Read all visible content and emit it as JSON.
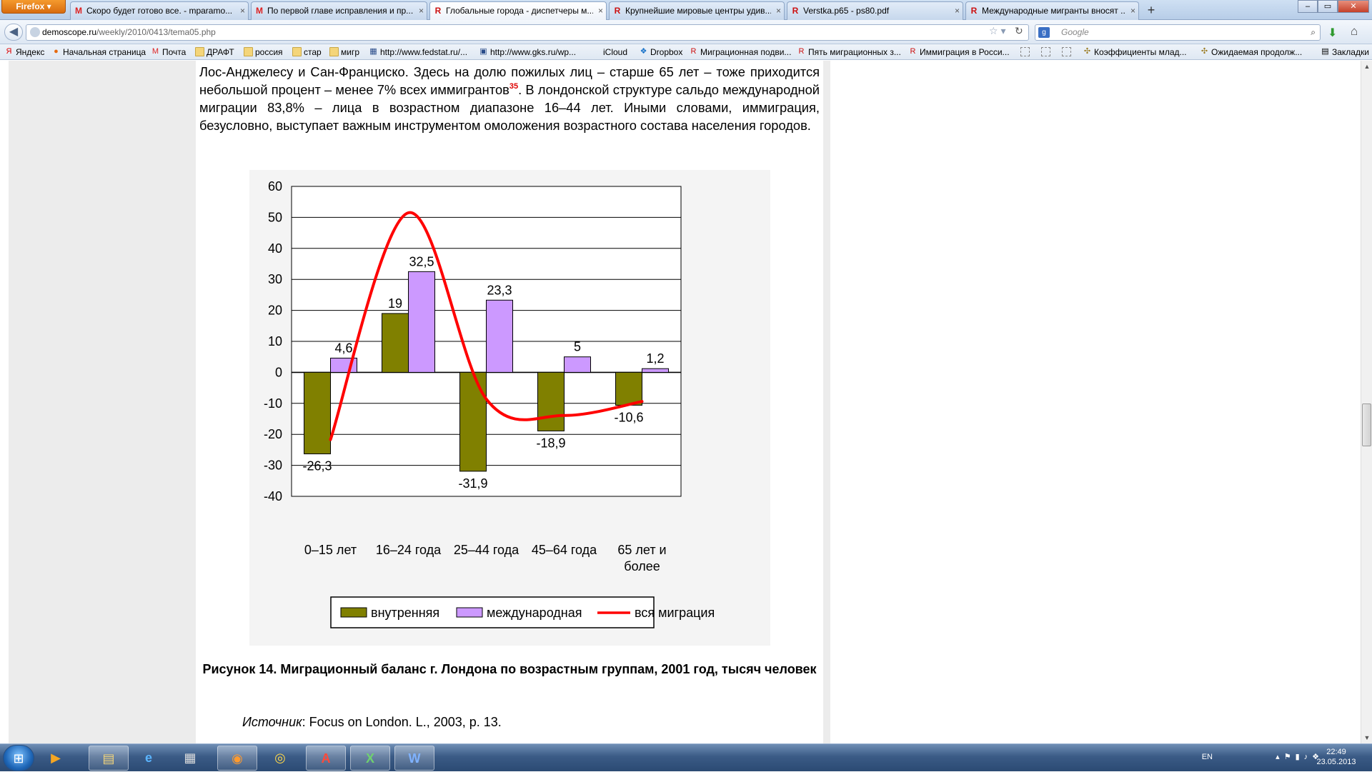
{
  "browser": {
    "menu_button": "Firefox",
    "tabs": [
      {
        "icon": "gmail-icon",
        "label": "Скоро будет готово все. - mparamo...",
        "active": false
      },
      {
        "icon": "gmail-icon",
        "label": "По первой главе исправления и пр...",
        "active": false
      },
      {
        "icon": "demoscope-icon",
        "label": "Глобальные города - диспетчеры м...",
        "active": true
      },
      {
        "icon": "demoscope-icon",
        "label": "Крупнейшие мировые центры удив...",
        "active": false
      },
      {
        "icon": "demoscope-icon",
        "label": "Verstka.p65 - ps80.pdf",
        "active": false
      },
      {
        "icon": "demoscope-icon",
        "label": "Международные мигранты вносят ...",
        "active": false
      }
    ],
    "new_tab": "+",
    "url_domain": "demoscope.ru",
    "url_path": "/weekly/2010/0413/tema05.php",
    "search_placeholder": "Google",
    "bookmarks": [
      {
        "label": "Яндекс",
        "icon": "yandex-icon"
      },
      {
        "label": "Начальная страница",
        "icon": "firefox-icon"
      },
      {
        "label": "Почта",
        "icon": "gmail-icon"
      },
      {
        "label": "ДРАФТ",
        "icon": "folder-icon"
      },
      {
        "label": "россия",
        "icon": "folder-icon"
      },
      {
        "label": "стар",
        "icon": "folder-icon"
      },
      {
        "label": "мигр",
        "icon": "folder-icon"
      },
      {
        "label": "http://www.fedstat.ru/...",
        "icon": "fedstat-icon"
      },
      {
        "label": "http://www.gks.ru/wp...",
        "icon": "gks-icon"
      },
      {
        "label": "iCloud",
        "icon": "apple-icon"
      },
      {
        "label": "Dropbox",
        "icon": "dropbox-icon"
      },
      {
        "label": "Миграционная подви...",
        "icon": "demoscope-icon"
      },
      {
        "label": "Пять миграционных з...",
        "icon": "demoscope-icon"
      },
      {
        "label": "Иммиграция в Росси...",
        "icon": "demoscope-icon"
      },
      {
        "label": "",
        "icon": "blank-page-icon"
      },
      {
        "label": "",
        "icon": "blank-page-icon"
      },
      {
        "label": "",
        "icon": "blank-page-icon"
      },
      {
        "label": "Коэффициенты млад...",
        "icon": "emblem-icon"
      },
      {
        "label": "Ожидаемая продолж...",
        "icon": "emblem-icon"
      }
    ],
    "bookmarks_menu": "Закладки"
  },
  "article": {
    "paragraph_before_sup": "Лос-Анджелесу и Сан-Франциско. Здесь на долю пожилых лиц – старше 65 лет – тоже приходится небольшой процент – менее 7% всех иммигрантов",
    "footnote": "35",
    "paragraph_after_sup": ". В лондонской структуре сальдо международной миграции 83,8% – лица в возрастном диапазоне 16–44 лет. Иными словами, иммиграция, безусловно, выступает важным инструментом омоложения возрастного состава населения городов.",
    "caption": "Рисунок 14. Миграционный баланс г. Лондона по возрастным группам, 2001 год, тысяч человек",
    "source_label": "Источник",
    "source_text": ": Focus on London. L., 2003, p. 13."
  },
  "chart_data": {
    "type": "bar",
    "categories": [
      "0–15 лет",
      "16–24 года",
      "25–44 года",
      "45–64 года",
      "65 лет и более"
    ],
    "series": [
      {
        "name": "внутренняя",
        "type": "bar",
        "color": "#808000",
        "values": [
          -26.3,
          19,
          -31.9,
          -18.9,
          -10.6
        ],
        "value_labels": [
          "-26,3",
          "19",
          "-31,9",
          "-18,9",
          "-10,6"
        ]
      },
      {
        "name": "международная",
        "type": "bar",
        "color": "#cc99ff",
        "values": [
          4.6,
          32.5,
          23.3,
          5,
          1.2
        ],
        "value_labels": [
          "4,6",
          "32,5",
          "23,3",
          "5",
          "1,2"
        ]
      },
      {
        "name": "вся миграция",
        "type": "line",
        "color": "#ff0000",
        "smooth": true,
        "values": [
          -21.7,
          51.5,
          -8.6,
          -13.9,
          -9.4
        ]
      }
    ],
    "ylim": [
      -40,
      60
    ],
    "yticks": [
      "-40",
      "-30",
      "-20",
      "-10",
      "0",
      "10",
      "20",
      "30",
      "40",
      "50",
      "60"
    ],
    "grid": true,
    "legend_position": "bottom"
  },
  "taskbar": {
    "start": "start",
    "apps": [
      {
        "icon": "media-player-icon",
        "open": false
      },
      {
        "icon": "explorer-folder-icon",
        "open": true
      },
      {
        "icon": "internet-explorer-icon",
        "open": false
      },
      {
        "icon": "app-icon",
        "open": false
      },
      {
        "icon": "firefox-icon",
        "open": true
      },
      {
        "icon": "chrome-icon",
        "open": false
      },
      {
        "icon": "acrobat-icon",
        "open": true
      },
      {
        "icon": "excel-icon",
        "open": true
      },
      {
        "icon": "word-icon",
        "open": true
      }
    ],
    "language": "EN",
    "time": "22:49",
    "date": "23.05.2013"
  }
}
